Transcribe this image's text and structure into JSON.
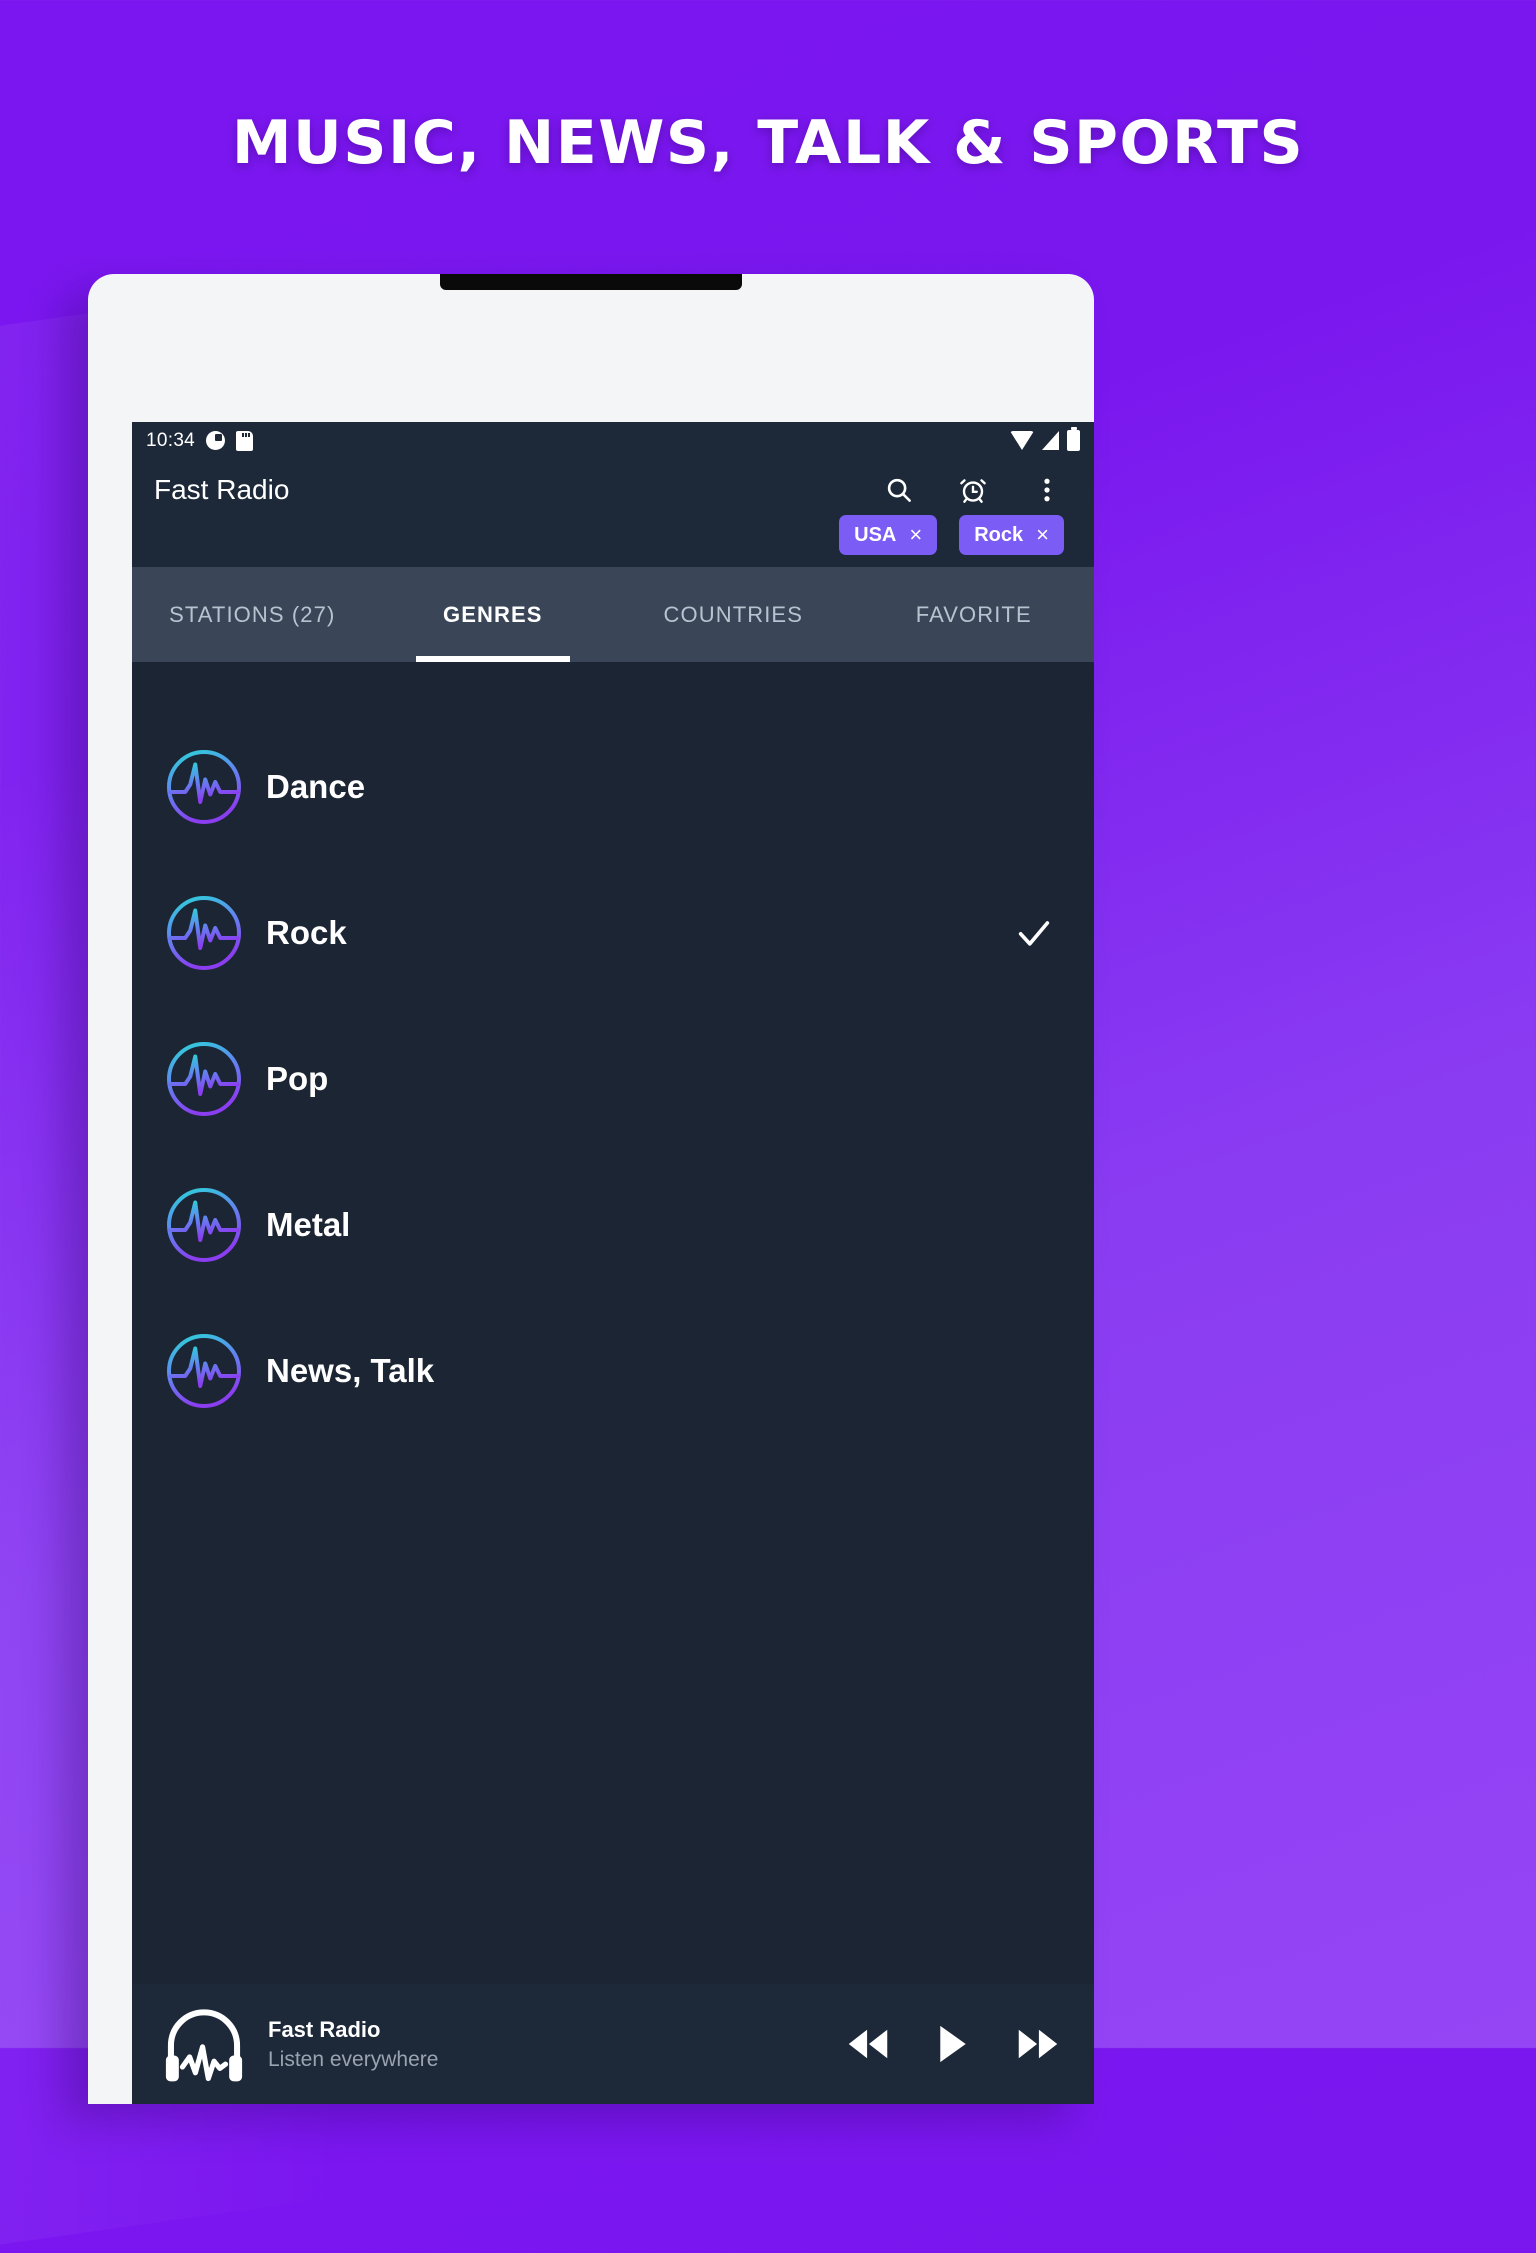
{
  "headline": "MUSIC, NEWS, TALK & SPORTS",
  "status_bar": {
    "time": "10:34",
    "left_icons": [
      "pie-chart-icon",
      "sd-card-icon"
    ],
    "right_icons": [
      "wifi-icon",
      "cellular-signal-icon",
      "battery-icon"
    ]
  },
  "app_bar": {
    "title": "Fast Radio",
    "actions": [
      "search-icon",
      "alarm-icon",
      "overflow-menu-icon"
    ]
  },
  "filter_chips": [
    {
      "label": "USA",
      "remove": "×"
    },
    {
      "label": "Rock",
      "remove": "×"
    }
  ],
  "tabs": [
    {
      "label": "STATIONS (27)",
      "active": false
    },
    {
      "label": "GENRES",
      "active": true
    },
    {
      "label": "COUNTRIES",
      "active": false
    },
    {
      "label": "FAVORITE",
      "active": false
    }
  ],
  "genres": [
    {
      "label": "Dance",
      "selected": false
    },
    {
      "label": "Rock",
      "selected": true
    },
    {
      "label": "Pop",
      "selected": false
    },
    {
      "label": "Metal",
      "selected": false
    },
    {
      "label": "News, Talk",
      "selected": false
    }
  ],
  "player": {
    "title": "Fast Radio",
    "subtitle": "Listen everywhere",
    "controls": [
      "previous-button",
      "play-button",
      "next-button"
    ]
  },
  "colors": {
    "background_start": "#7b16f0",
    "background_end": "#9645f5",
    "chip": "#7b5cf5",
    "app_bar": "#1d2838",
    "tab_bar": "#3a4657",
    "list_bg": "#1b2533",
    "icon_gradient_start": "#2ad7d7",
    "icon_gradient_end": "#8b3df0",
    "accent_text": "#ffffff"
  }
}
